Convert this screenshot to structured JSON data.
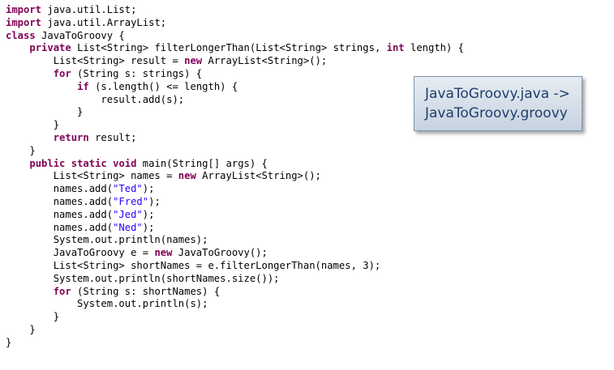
{
  "code": {
    "lines": [
      [
        {
          "t": "import",
          "k": "kw"
        },
        {
          "t": " java.util.List;"
        }
      ],
      [
        {
          "t": "import",
          "k": "kw"
        },
        {
          "t": " java.util.ArrayList;"
        }
      ],
      [
        {
          "t": "class",
          "k": "kw"
        },
        {
          "t": " JavaToGroovy {"
        }
      ],
      [
        {
          "t": "    "
        },
        {
          "t": "private",
          "k": "kw"
        },
        {
          "t": " List<String> filterLongerThan(List<String> strings, "
        },
        {
          "t": "int",
          "k": "kw"
        },
        {
          "t": " length) {"
        }
      ],
      [
        {
          "t": "        List<String> result = "
        },
        {
          "t": "new",
          "k": "kw"
        },
        {
          "t": " ArrayList<String>();"
        }
      ],
      [
        {
          "t": "        "
        },
        {
          "t": "for",
          "k": "kw"
        },
        {
          "t": " (String s: strings) {"
        }
      ],
      [
        {
          "t": "            "
        },
        {
          "t": "if",
          "k": "kw"
        },
        {
          "t": " (s.length() <= length) {"
        }
      ],
      [
        {
          "t": "                result.add(s);"
        }
      ],
      [
        {
          "t": "            }"
        }
      ],
      [
        {
          "t": "        }"
        }
      ],
      [
        {
          "t": "        "
        },
        {
          "t": "return",
          "k": "kw"
        },
        {
          "t": " result;"
        }
      ],
      [
        {
          "t": "    }"
        }
      ],
      [
        {
          "t": "    "
        },
        {
          "t": "public",
          "k": "kw"
        },
        {
          "t": " "
        },
        {
          "t": "static",
          "k": "kw"
        },
        {
          "t": " "
        },
        {
          "t": "void",
          "k": "kw"
        },
        {
          "t": " main(String[] args) {"
        }
      ],
      [
        {
          "t": "        List<String> names = "
        },
        {
          "t": "new",
          "k": "kw"
        },
        {
          "t": " ArrayList<String>();"
        }
      ],
      [
        {
          "t": "        names.add("
        },
        {
          "t": "\"Ted\"",
          "k": "str"
        },
        {
          "t": ");"
        }
      ],
      [
        {
          "t": "        names.add("
        },
        {
          "t": "\"Fred\"",
          "k": "str"
        },
        {
          "t": ");"
        }
      ],
      [
        {
          "t": "        names.add("
        },
        {
          "t": "\"Jed\"",
          "k": "str"
        },
        {
          "t": ");"
        }
      ],
      [
        {
          "t": "        names.add("
        },
        {
          "t": "\"Ned\"",
          "k": "str"
        },
        {
          "t": ");"
        }
      ],
      [
        {
          "t": "        System.out.println(names);"
        }
      ],
      [
        {
          "t": "        JavaToGroovy e = "
        },
        {
          "t": "new",
          "k": "kw"
        },
        {
          "t": " JavaToGroovy();"
        }
      ],
      [
        {
          "t": "        List<String> shortNames = e.filterLongerThan(names, 3);"
        }
      ],
      [
        {
          "t": "        System.out.println(shortNames.size());"
        }
      ],
      [
        {
          "t": "        "
        },
        {
          "t": "for",
          "k": "kw"
        },
        {
          "t": " (String s: shortNames) {"
        }
      ],
      [
        {
          "t": "            System.out.println(s);"
        }
      ],
      [
        {
          "t": "        }"
        }
      ],
      [
        {
          "t": "    }"
        }
      ],
      [
        {
          "t": "}"
        }
      ]
    ]
  },
  "callout": {
    "line1": "JavaToGroovy.java ->",
    "line2": "JavaToGroovy.groovy"
  },
  "colors": {
    "keyword": "#7f0055",
    "string_literal": "#2a00ff",
    "plain_text": "#000000",
    "callout_text": "#1f3e6c",
    "callout_fill": "#d6dfe9",
    "callout_border": "#7f95ab",
    "background": "#ffffff"
  }
}
